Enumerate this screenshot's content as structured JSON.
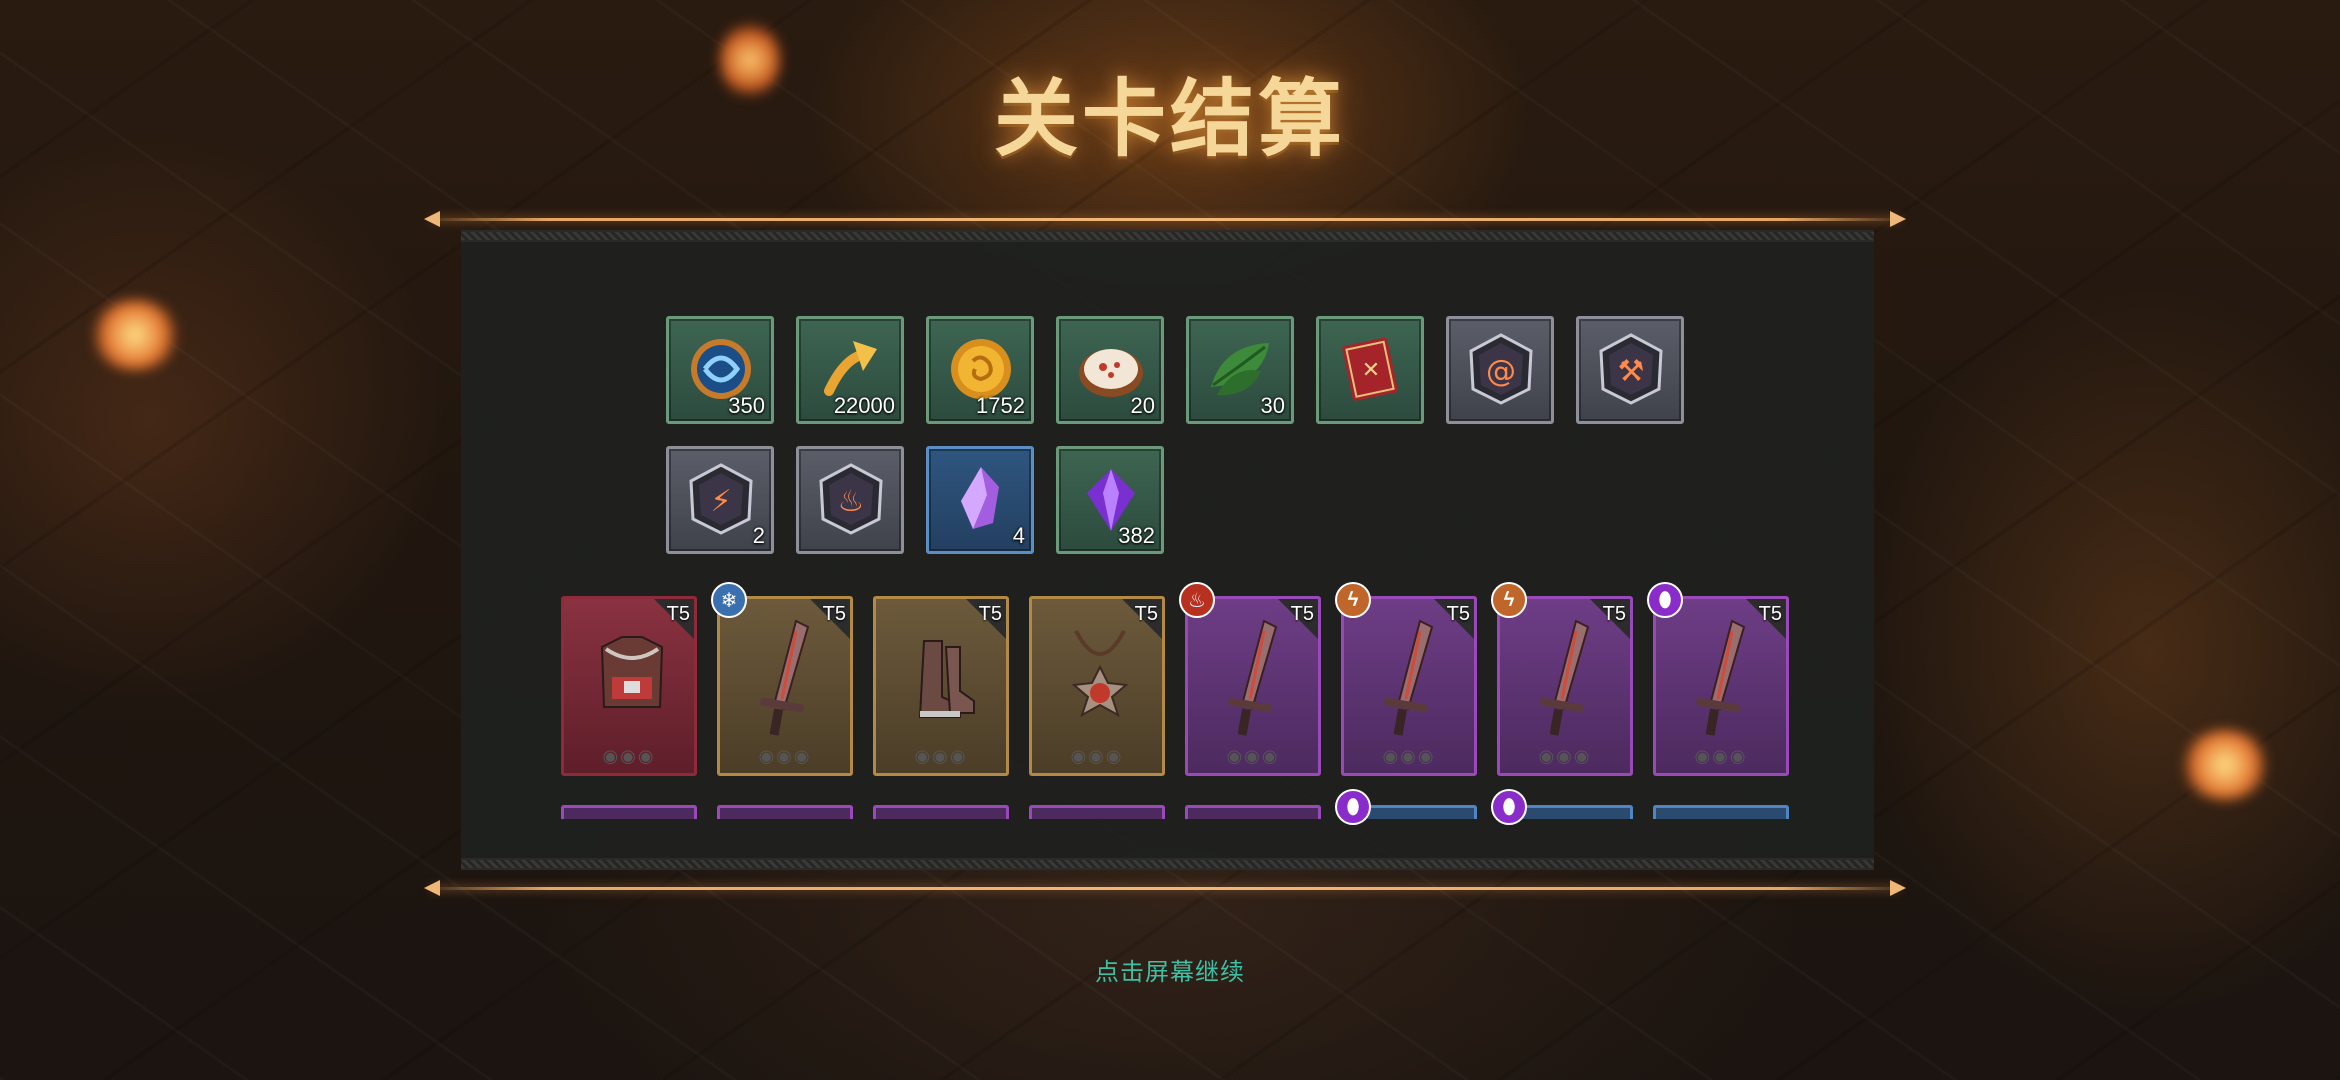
{
  "title": "关卡结算",
  "continue_hint": "点击屏幕继续",
  "rewards_row1": [
    {
      "icon": "blue-orb-token-icon",
      "count": "350",
      "frame": "green"
    },
    {
      "icon": "golden-arrow-icon",
      "count": "22000",
      "frame": "green"
    },
    {
      "icon": "gold-coin-icon",
      "count": "1752",
      "frame": "green"
    },
    {
      "icon": "dumpling-plate-icon",
      "count": "20",
      "frame": "green"
    },
    {
      "icon": "green-leaf-icon",
      "count": "30",
      "frame": "green"
    },
    {
      "icon": "red-spellbook-icon",
      "count": "",
      "frame": "green"
    },
    {
      "icon": "wind-rune-stone-icon",
      "count": "",
      "frame": "gray"
    },
    {
      "icon": "axe-rune-stone-icon",
      "count": "",
      "frame": "gray"
    }
  ],
  "rewards_row2": [
    {
      "icon": "lightning-rune-stone-icon",
      "count": "2",
      "frame": "gray"
    },
    {
      "icon": "fire-rune-stone-icon",
      "count": "",
      "frame": "gray"
    },
    {
      "icon": "purple-crystal-icon",
      "count": "4",
      "frame": "blue"
    },
    {
      "icon": "amethyst-gem-icon",
      "count": "382",
      "frame": "green"
    }
  ],
  "gear_tier_label": "T5",
  "gear": [
    {
      "icon": "armor-chest-icon",
      "rarity": "red",
      "element": ""
    },
    {
      "icon": "sword-icon",
      "rarity": "gold",
      "element": "ice"
    },
    {
      "icon": "boots-icon",
      "rarity": "gold",
      "element": ""
    },
    {
      "icon": "amulet-icon",
      "rarity": "gold",
      "element": ""
    },
    {
      "icon": "sword-icon",
      "rarity": "purple",
      "element": "fire"
    },
    {
      "icon": "sword-icon",
      "rarity": "purple",
      "element": "lightning"
    },
    {
      "icon": "sword-icon",
      "rarity": "purple",
      "element": "lightning"
    },
    {
      "icon": "sword-icon",
      "rarity": "purple",
      "element": "poison"
    }
  ],
  "colors": {
    "title": "#f6d79a",
    "continue": "#3fbfa4",
    "frame_green": "#6a9a7a",
    "frame_gray": "#8d9099",
    "frame_blue": "#5b8fc4",
    "rarity_red": "#8f2a3a",
    "rarity_gold": "#b38a43",
    "rarity_purple": "#9a4ab8",
    "element_ice": "#3a6fb0",
    "element_fire": "#b83020",
    "element_lightning": "#c0662a",
    "element_poison": "#8a2cc9"
  }
}
